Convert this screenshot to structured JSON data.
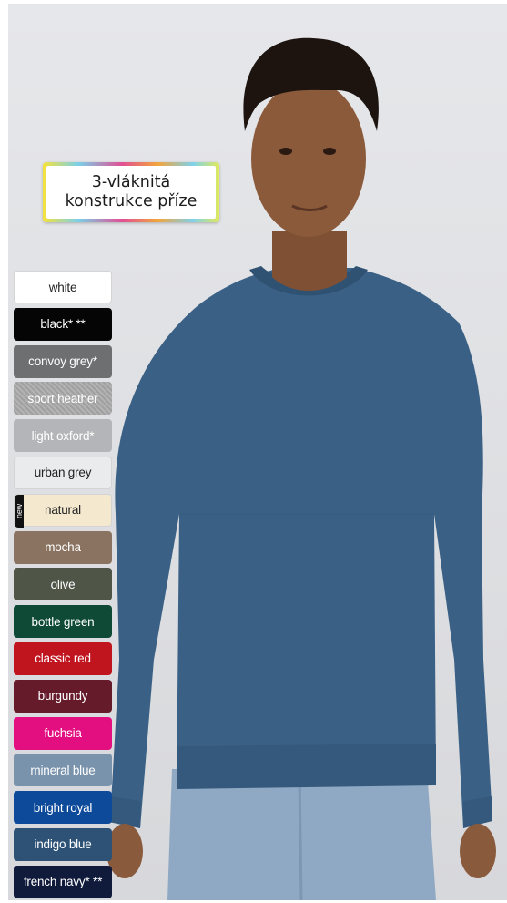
{
  "feature_badge": {
    "line1": "3-vláknitá",
    "line2": "konstrukce příze"
  },
  "colors": [
    {
      "label": "white",
      "bg": "#ffffff",
      "fg": "#222222"
    },
    {
      "label": "black* **",
      "bg": "#050505",
      "fg": "#ffffff"
    },
    {
      "label": "convoy grey*",
      "bg": "#6e6f71",
      "fg": "#ffffff"
    },
    {
      "label": "sport heather",
      "bg": "#a9a9a9",
      "fg": "#ffffff"
    },
    {
      "label": "light oxford*",
      "bg": "#b3b5b8",
      "fg": "#ffffff"
    },
    {
      "label": "urban grey",
      "bg": "#eaebed",
      "fg": "#222222"
    },
    {
      "label": "natural",
      "bg": "#f4e8cf",
      "fg": "#222222",
      "badge": "new"
    },
    {
      "label": "mocha",
      "bg": "#8a7461",
      "fg": "#ffffff"
    },
    {
      "label": "olive",
      "bg": "#4f5547",
      "fg": "#ffffff"
    },
    {
      "label": "bottle green",
      "bg": "#0f4a36",
      "fg": "#ffffff"
    },
    {
      "label": "classic red",
      "bg": "#c0141f",
      "fg": "#ffffff"
    },
    {
      "label": "burgundy",
      "bg": "#651b2a",
      "fg": "#ffffff"
    },
    {
      "label": "fuchsia",
      "bg": "#e30e80",
      "fg": "#ffffff"
    },
    {
      "label": "mineral blue",
      "bg": "#7a93ad",
      "fg": "#ffffff"
    },
    {
      "label": "bright royal",
      "bg": "#0d4a9a",
      "fg": "#ffffff"
    },
    {
      "label": "indigo blue",
      "bg": "#2d5276",
      "fg": "#ffffff"
    },
    {
      "label": "french navy* **",
      "bg": "#101b3c",
      "fg": "#ffffff"
    }
  ]
}
